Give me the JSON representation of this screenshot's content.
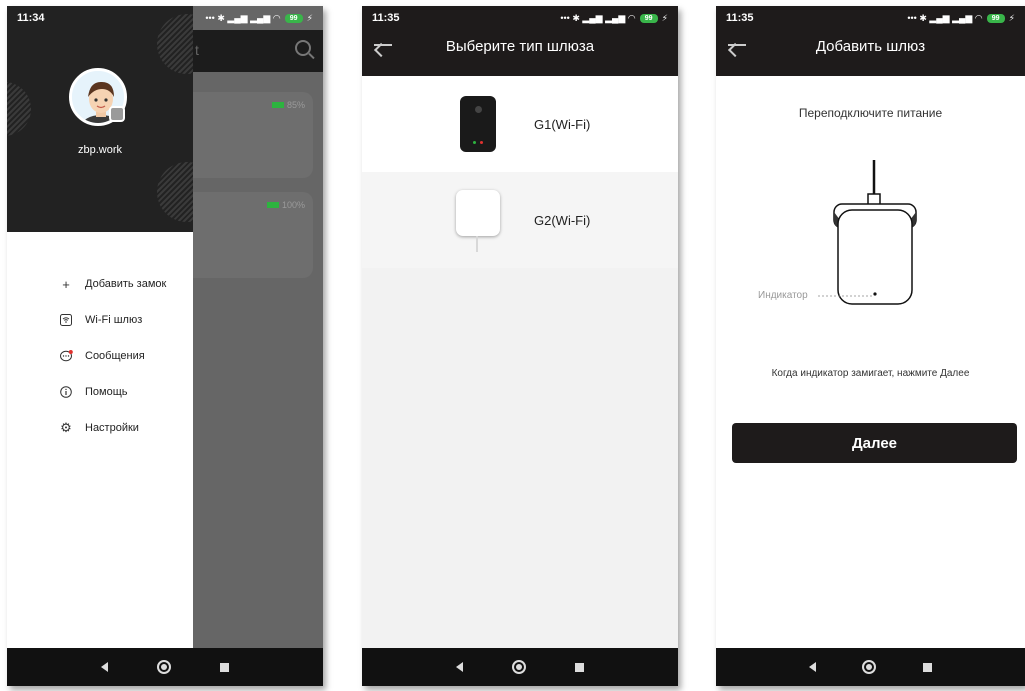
{
  "screens": [
    {
      "status": {
        "time": "11:34",
        "battery": "99"
      },
      "background": {
        "title_fragment": "t",
        "cards": [
          {
            "battery": "85%"
          },
          {
            "battery": "100%"
          }
        ]
      },
      "drawer": {
        "username": "zbp.work",
        "menu": [
          {
            "label": "Добавить замок",
            "icon": "plus-icon"
          },
          {
            "label": "Wi-Fi шлюз",
            "icon": "wifi-gateway-icon"
          },
          {
            "label": "Сообщения",
            "icon": "message-icon"
          },
          {
            "label": "Помощь",
            "icon": "info-icon"
          },
          {
            "label": "Настройки",
            "icon": "gear-icon"
          }
        ]
      }
    },
    {
      "status": {
        "time": "11:35",
        "battery": "99"
      },
      "title": "Выберите тип шлюза",
      "gateways": [
        {
          "label": "G1(Wi-Fi)"
        },
        {
          "label": "G2(Wi-Fi)"
        }
      ]
    },
    {
      "status": {
        "time": "11:35",
        "battery": "99"
      },
      "title": "Добавить шлюз",
      "heading": "Переподключите питание",
      "indicator_label": "Индикатор",
      "hint": "Когда индикатор замигает, нажмите Далее",
      "next_label": "Далее"
    }
  ],
  "colors": {
    "accent_dark": "#1e1b1b",
    "battery_green": "#39b54a",
    "led_red": "#e0322f"
  }
}
